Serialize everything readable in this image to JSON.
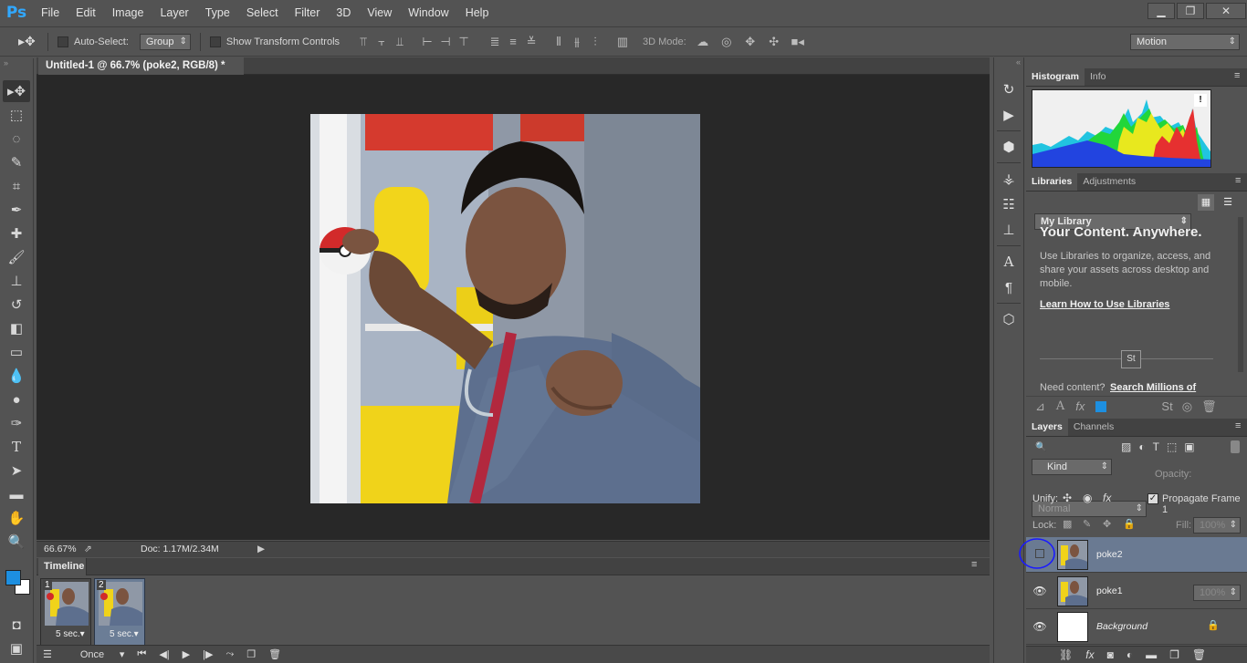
{
  "app": {
    "logo": "Ps"
  },
  "menu": [
    "File",
    "Edit",
    "Image",
    "Layer",
    "Type",
    "Select",
    "Filter",
    "3D",
    "View",
    "Window",
    "Help"
  ],
  "window_controls": {
    "minimize": "▁",
    "restore": "❐",
    "close": "✕"
  },
  "options": {
    "auto_select_label": "Auto-Select:",
    "auto_select_value": "Group",
    "transform_label": "Show Transform Controls",
    "mode3d_label": "3D Mode:",
    "workspace": "Motion"
  },
  "document": {
    "tab_title": "Untitled-1 @ 66.7% (poke2, RGB/8) *",
    "tab_close": "×",
    "zoom": "66.67%",
    "doc_size": "Doc: 1.17M/2.34M"
  },
  "timeline": {
    "title": "Timeline",
    "frames": [
      {
        "num": "1",
        "duration": "5 sec.▾"
      },
      {
        "num": "2",
        "duration": "5 sec.▾"
      }
    ],
    "loop": "Once"
  },
  "histogram": {
    "tabs": [
      "Histogram",
      "Info"
    ],
    "warning": "!"
  },
  "libraries": {
    "tabs": [
      "Libraries",
      "Adjustments"
    ],
    "library": "My Library",
    "heading": "Your Content. Anywhere.",
    "body": "Use Libraries to organize, access, and share your assets across desktop and mobile.",
    "learn_link": "Learn How to Use Libraries",
    "stock_badge": "St",
    "need_content": "Need content?",
    "search_link": "Search Millions of"
  },
  "layers": {
    "tabs": [
      "Layers",
      "Channels"
    ],
    "filter": "Kind",
    "blend": "Normal",
    "opacity_label": "Opacity:",
    "opacity": "100%",
    "unify_label": "Unify:",
    "propagate_label": "Propagate Frame 1",
    "lock_label": "Lock:",
    "fill_label": "Fill:",
    "fill": "100%",
    "items": [
      {
        "name": "poke2",
        "visible": false,
        "selected": true
      },
      {
        "name": "poke1",
        "visible": true,
        "selected": false
      },
      {
        "name": "Background",
        "visible": true,
        "selected": false,
        "locked": true
      }
    ]
  },
  "colors": {
    "foreground": "#1d8fe0",
    "background": "#ffffff",
    "accent_ps": "#31a8ff",
    "annotation_circle": "#1a1aff"
  }
}
